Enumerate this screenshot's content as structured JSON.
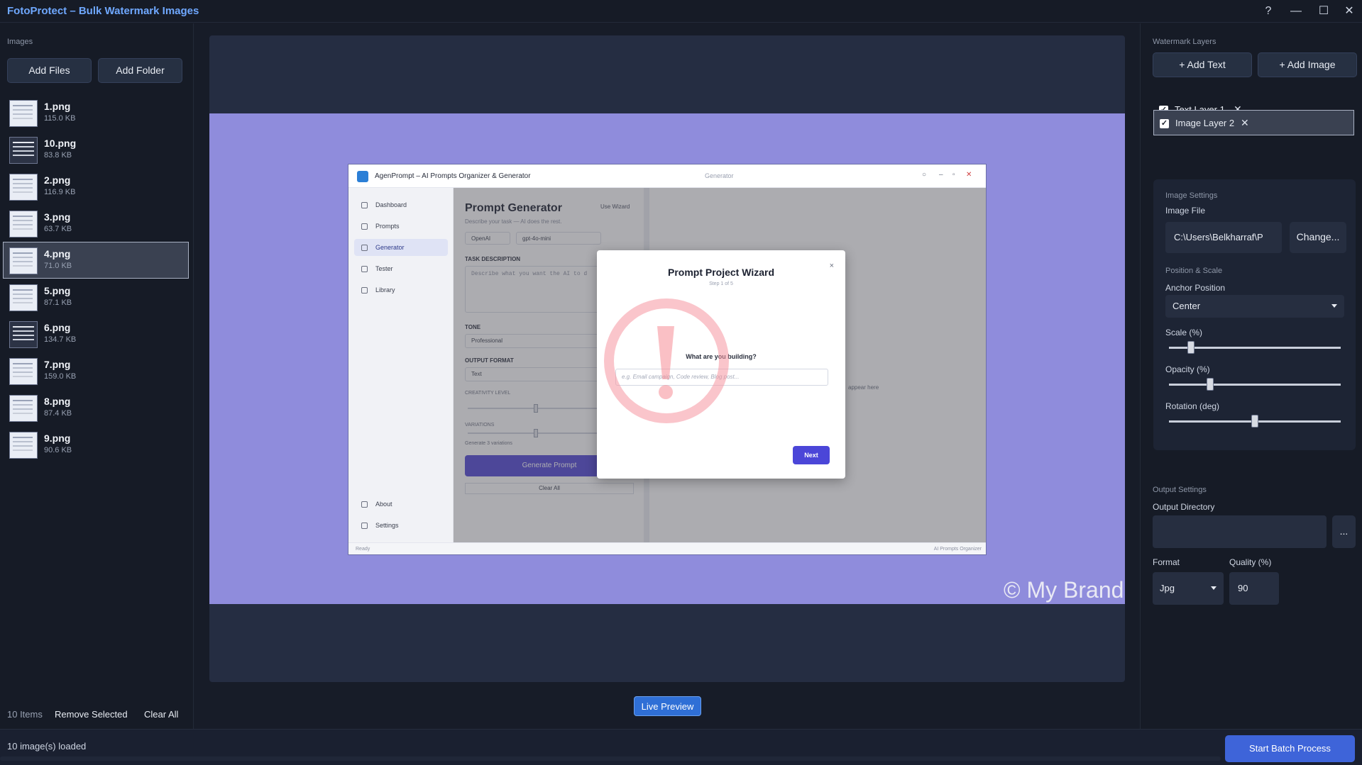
{
  "window": {
    "title": "FotoProtect – Bulk Watermark Images",
    "controls": [
      "?",
      "—",
      "☐",
      "✕"
    ]
  },
  "left": {
    "section_label": "Images",
    "add_files": "Add Files",
    "add_folder": "Add Folder",
    "files": [
      {
        "name": "1.png",
        "size": "115.0 KB"
      },
      {
        "name": "10.png",
        "size": "83.8 KB"
      },
      {
        "name": "2.png",
        "size": "116.9 KB"
      },
      {
        "name": "3.png",
        "size": "63.7 KB"
      },
      {
        "name": "4.png",
        "size": "71.0 KB"
      },
      {
        "name": "5.png",
        "size": "87.1 KB"
      },
      {
        "name": "6.png",
        "size": "134.7 KB"
      },
      {
        "name": "7.png",
        "size": "159.0 KB"
      },
      {
        "name": "8.png",
        "size": "87.4 KB"
      },
      {
        "name": "9.png",
        "size": "90.6 KB"
      }
    ],
    "selected_file": "4.png",
    "count": "10 Items",
    "remove_selected": "Remove Selected",
    "clear_all": "Clear All"
  },
  "preview": {
    "inner_app": {
      "title": "AgenPrompt – AI Prompts Organizer & Generator",
      "center_title": "Generator",
      "nav": [
        "Dashboard",
        "Prompts",
        "Generator",
        "Tester",
        "Library"
      ],
      "nav_bottom": [
        "About",
        "Settings"
      ],
      "heading": "Prompt Generator",
      "subheading": "Describe your task — AI does the rest.",
      "use_wizard": "Use Wizard",
      "provider": "OpenAI",
      "model": "gpt-4o-mini",
      "task_label": "TASK DESCRIPTION",
      "task_placeholder": "Describe what you want the AI to d",
      "tone_label": "TONE",
      "tone_value": "Professional",
      "format_label": "OUTPUT FORMAT",
      "format_value": "Text",
      "creativity_label": "CREATIVITY LEVEL",
      "variations_label": "VARIATIONS",
      "variations_note": "Generate 3 variations",
      "generate_button": "Generate Prompt",
      "clear_button": "Clear All",
      "status_left": "Ready",
      "status_right": "AI Prompts Organizer",
      "appear_text": "appear here"
    },
    "modal": {
      "title": "Prompt Project Wizard",
      "step": "Step 1 of 5",
      "question": "What are you building?",
      "placeholder": "e.g. Email campaign, Code review, Blog post...",
      "next": "Next",
      "close": "×"
    },
    "watermark_text": "© My Brand",
    "live_preview": "Live Preview"
  },
  "right": {
    "layers_label": "Watermark Layers",
    "add_text": "+ Add Text",
    "add_image": "+ Add Image",
    "layers": [
      {
        "name": "Text Layer 1",
        "checked": true
      },
      {
        "name": "Image Layer 2",
        "checked": true
      }
    ],
    "image_settings_label": "Image Settings",
    "image_file_label": "Image File",
    "image_file_value": "C:\\Users\\Belkharraf\\P",
    "change": "Change...",
    "position_scale_label": "Position & Scale",
    "anchor_label": "Anchor Position",
    "anchor_value": "Center",
    "scale_label": "Scale (%)",
    "scale_value": 0.13,
    "opacity_label": "Opacity (%)",
    "opacity_value": 0.24,
    "rotation_label": "Rotation (deg)",
    "rotation_value": 0.5,
    "output_label": "Output Settings",
    "output_dir_label": "Output Directory",
    "output_dir_value": "",
    "browse": "...",
    "format_label": "Format",
    "format_value": "Jpg",
    "quality_label": "Quality (%)",
    "quality_value": "90"
  },
  "status": {
    "text": "10 image(s) loaded",
    "start": "Start Batch Process"
  },
  "colors": {
    "accent": "#3e64d9",
    "title": "#6fa8ff",
    "preview_bg": "#8f8cdc",
    "watermark": "#f29aa3"
  }
}
